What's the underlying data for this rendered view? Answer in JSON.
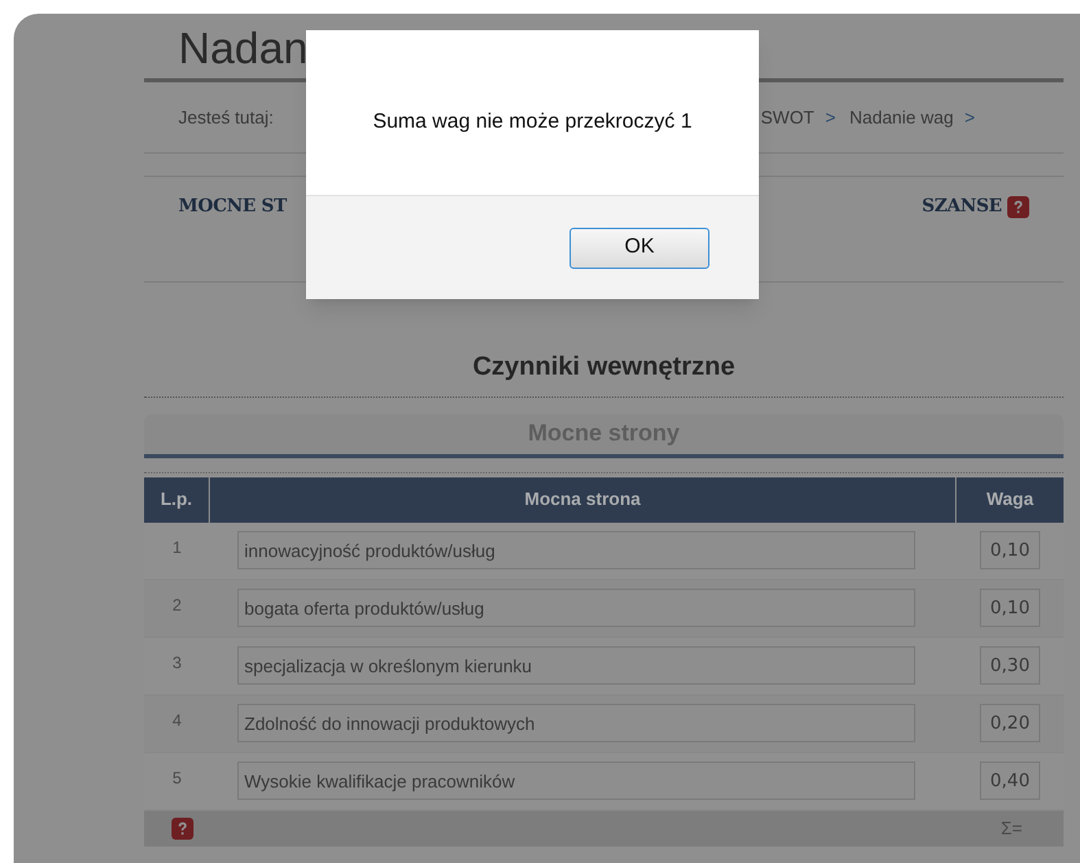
{
  "page_title": "Nadan",
  "breadcrumb": {
    "label": "Jesteś tutaj:",
    "items": [
      {
        "text": "SWOT",
        "separator": ">"
      },
      {
        "text": "Nadanie wag",
        "separator": ">"
      }
    ]
  },
  "tabs": [
    {
      "label": "MOCNE ST",
      "help": false
    },
    {
      "label": "SZANSE",
      "help": true
    }
  ],
  "section_title": "Czynniki wewnętrzne",
  "panel_title": "Mocne strony",
  "table": {
    "columns": [
      "L.p.",
      "Mocna strona",
      "Waga"
    ],
    "rows": [
      {
        "number": "1",
        "name": "innowacyjność produktów/usług",
        "weight": "0,10"
      },
      {
        "number": "2",
        "name": "bogata oferta produktów/usług",
        "weight": "0,10"
      },
      {
        "number": "3",
        "name": "specjalizacja w określonym kierunku",
        "weight": "0,30"
      },
      {
        "number": "4",
        "name": "Zdolność do innowacji produktowych",
        "weight": "0,20"
      },
      {
        "number": "5",
        "name": "Wysokie kwalifikacje pracowników",
        "weight": "0,40"
      }
    ],
    "footer": {
      "help": true,
      "sum_label": "Σ="
    }
  },
  "dialog": {
    "message": "Suma wag nie może przekroczyć 1",
    "button": "OK"
  }
}
